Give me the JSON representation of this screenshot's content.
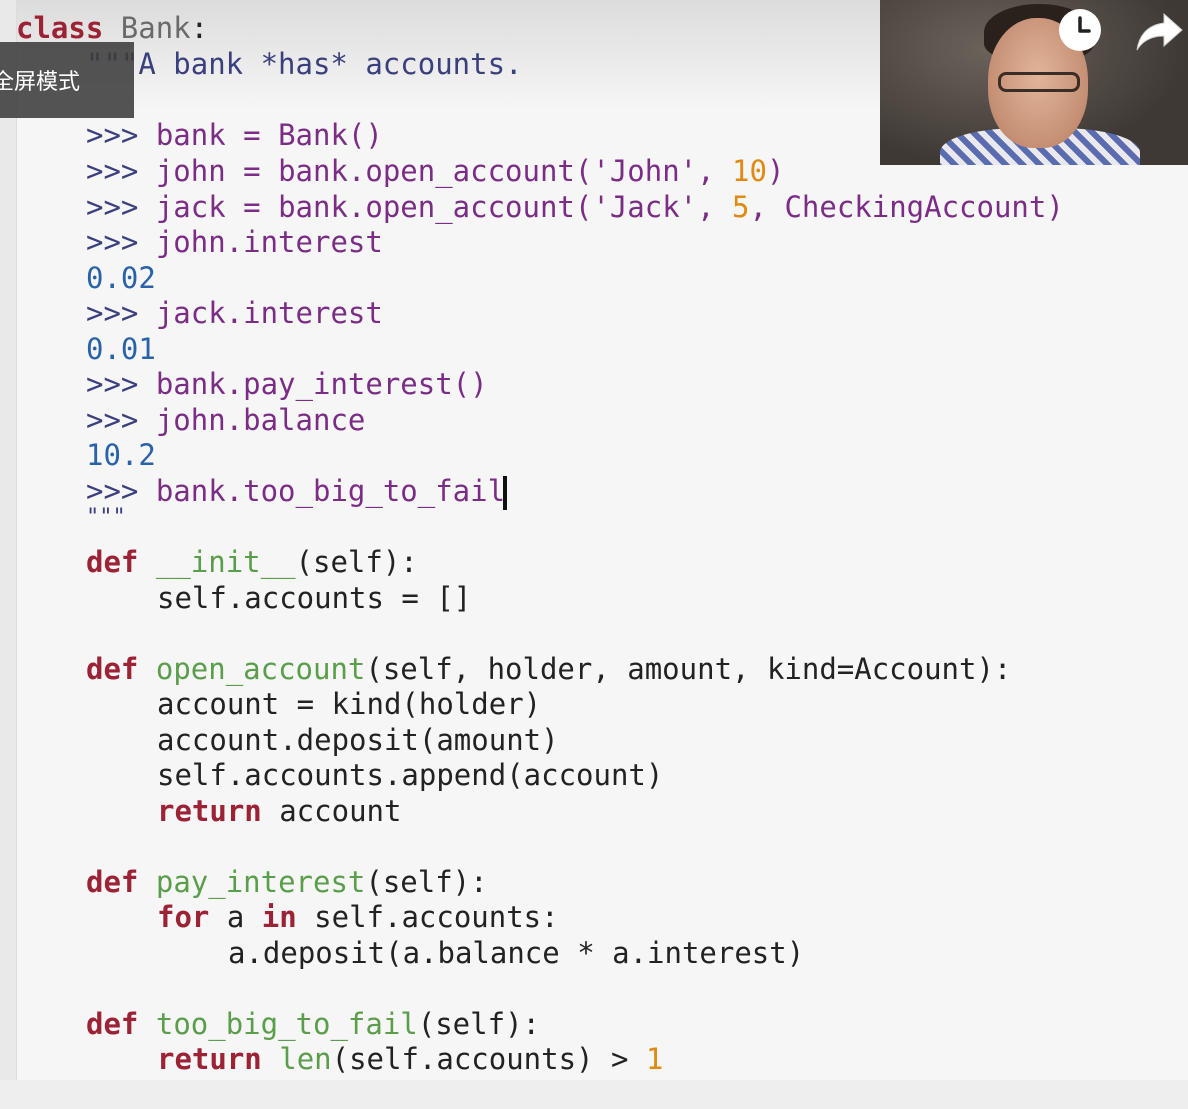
{
  "tooltip": {
    "text": "全屏模式"
  },
  "controls": {
    "watch_later_icon": "clock-icon",
    "share_icon": "share-arrow-icon"
  },
  "code": {
    "l1": [
      "class",
      " ",
      "Bank",
      ":"
    ],
    "l2": [
      "\"\"\"A bank *has* accounts."
    ],
    "l3": [
      ">>> ",
      "bank",
      " = ",
      "Bank",
      "()"
    ],
    "l4": [
      ">>> ",
      "john",
      " = ",
      "bank.open_account(",
      "'John'",
      ", ",
      "10",
      ")"
    ],
    "l5": [
      ">>> ",
      "jack",
      " = ",
      "bank.open_account(",
      "'Jack'",
      ", ",
      "5",
      ", ",
      "CheckingAccount",
      ")"
    ],
    "l6": [
      ">>> ",
      "john.interest"
    ],
    "l7": [
      "0.02"
    ],
    "l8": [
      ">>> ",
      "jack.interest"
    ],
    "l9": [
      "0.01"
    ],
    "l10": [
      ">>> ",
      "bank.pay_interest()"
    ],
    "l11": [
      ">>> ",
      "john.balance"
    ],
    "l12": [
      "10.2"
    ],
    "l13": [
      ">>> ",
      "bank.too_big_to_fail"
    ],
    "l14": [
      "\"\"\""
    ],
    "l15": [
      "def",
      " ",
      "__init__",
      "(self):"
    ],
    "l16": [
      "self.accounts = []"
    ],
    "l17": [
      "def",
      " ",
      "open_account",
      "(self, holder, amount, kind=Account):"
    ],
    "l18": [
      "account = kind(holder)"
    ],
    "l19": [
      "account.deposit(amount)"
    ],
    "l20": [
      "self.accounts.append(account)"
    ],
    "l21": [
      "return",
      " account"
    ],
    "l22": [
      "def",
      " ",
      "pay_interest",
      "(self):"
    ],
    "l23": [
      "for",
      " a ",
      "in",
      " self.accounts:"
    ],
    "l24": [
      "a.deposit(a.balance * a.interest)"
    ],
    "l25": [
      "def",
      " ",
      "too_big_to_fail",
      "(self):"
    ],
    "l26": [
      "return",
      " ",
      "len",
      "(self.accounts) > ",
      "1"
    ]
  }
}
